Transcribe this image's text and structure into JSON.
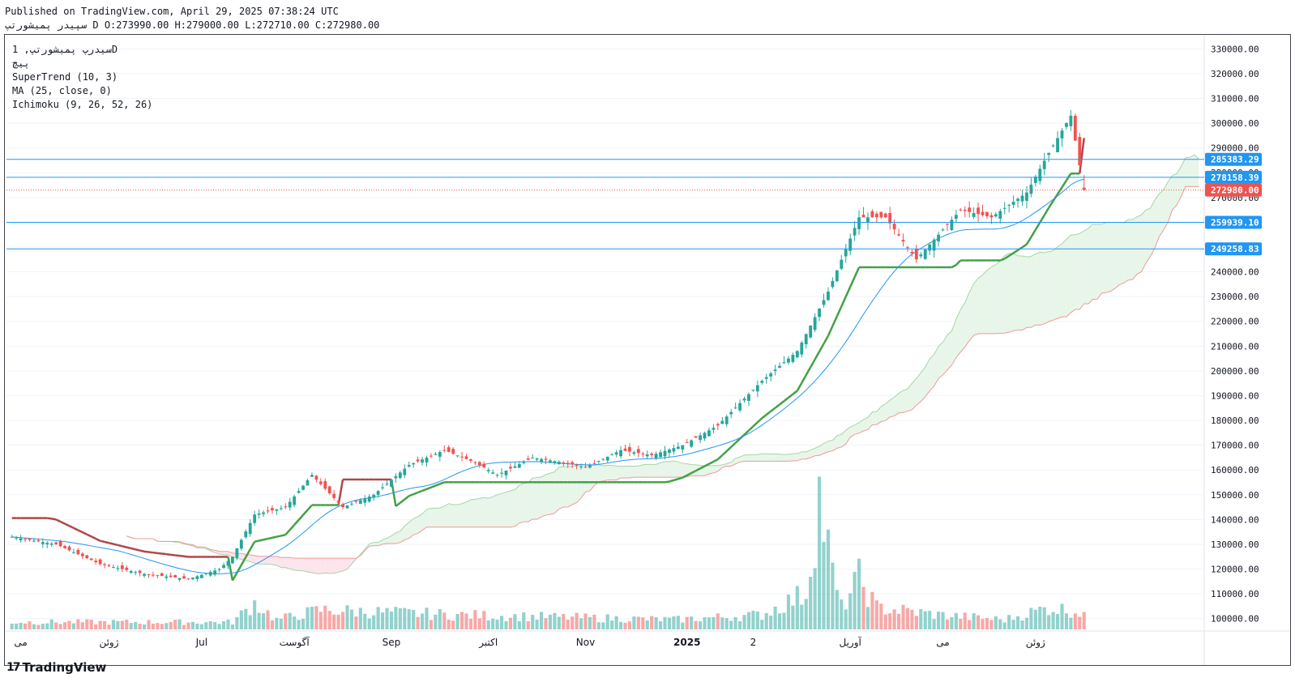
{
  "header": {
    "published": "Published on TradingView.com, April 29, 2025 07:38:24 UTC",
    "ohlc": "سپیدر پمیشورتپ D O:273990.00 H:279000.00 L:272710.00 C:272980.00"
  },
  "legend": {
    "symbol": "سیدرپ پمیشورتپ, 1D",
    "exchange": "پیچ",
    "supertrend": "SuperTrend (10, 3)",
    "ma": "MA (25, close, 0)",
    "ichimoku": "Ichimoku (9, 26, 52, 26)"
  },
  "footer": {
    "logo_mark": "17",
    "logo_text": "TradingView"
  },
  "colors": {
    "up": "#26a69a",
    "down": "#ef5350",
    "supertrend_up": "#43a047",
    "supertrend_down": "#b04547",
    "ma": "#2196f3",
    "cloud_green": "#e8f5e9",
    "cloud_red": "#fce4ec",
    "hline": "#2196f3",
    "price_label": "#ef5350",
    "level_label": "#2196f3"
  },
  "chart_data": {
    "type": "candlestick",
    "title": "",
    "ylim": [
      95000,
      335000
    ],
    "y_ticks": [
      100000,
      110000,
      120000,
      130000,
      140000,
      150000,
      160000,
      170000,
      180000,
      190000,
      200000,
      210000,
      220000,
      230000,
      240000,
      250000,
      260000,
      270000,
      280000,
      290000,
      300000,
      310000,
      320000,
      330000
    ],
    "x_labels": [
      "می",
      "ژوئن",
      "Jul",
      "آگوست",
      "Sep",
      "اکتبر",
      "Nov",
      "2025",
      "2",
      "آوریل",
      "می",
      "ژوئن"
    ],
    "horizontal_levels": [
      285383.29,
      278158.39,
      259939.1,
      249258.83
    ],
    "last_price": 272980.0,
    "closes_knots": [
      [
        0,
        133000
      ],
      [
        10,
        130000
      ],
      [
        20,
        122000
      ],
      [
        30,
        118000
      ],
      [
        40,
        116000
      ],
      [
        47,
        120000
      ],
      [
        50,
        125000
      ],
      [
        55,
        142000
      ],
      [
        62,
        145000
      ],
      [
        68,
        158000
      ],
      [
        75,
        145000
      ],
      [
        82,
        150000
      ],
      [
        90,
        162000
      ],
      [
        98,
        168000
      ],
      [
        105,
        163000
      ],
      [
        110,
        158000
      ],
      [
        118,
        165000
      ],
      [
        125,
        163000
      ],
      [
        130,
        161000
      ],
      [
        138,
        168000
      ],
      [
        145,
        166000
      ],
      [
        152,
        170000
      ],
      [
        160,
        178000
      ],
      [
        170,
        196000
      ],
      [
        178,
        208000
      ],
      [
        185,
        232000
      ],
      [
        192,
        262000
      ],
      [
        198,
        262000
      ],
      [
        205,
        245000
      ],
      [
        210,
        255000
      ],
      [
        215,
        265000
      ],
      [
        222,
        262000
      ],
      [
        230,
        272000
      ],
      [
        235,
        288000
      ],
      [
        240,
        303000
      ],
      [
        243,
        272980
      ]
    ],
    "volume_knots": [
      [
        0,
        3
      ],
      [
        50,
        3
      ],
      [
        55,
        11
      ],
      [
        60,
        4
      ],
      [
        70,
        8
      ],
      [
        100,
        6
      ],
      [
        150,
        4
      ],
      [
        170,
        6
      ],
      [
        180,
        15
      ],
      [
        183,
        55
      ],
      [
        186,
        22
      ],
      [
        188,
        9
      ],
      [
        192,
        21
      ],
      [
        196,
        9
      ],
      [
        210,
        6
      ],
      [
        225,
        4
      ],
      [
        235,
        9
      ],
      [
        243,
        7
      ]
    ],
    "total_bars": 244,
    "future_bars": 26
  }
}
